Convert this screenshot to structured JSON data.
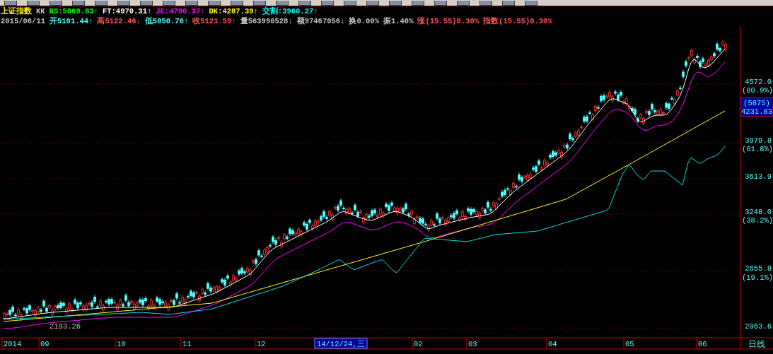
{
  "header": {
    "line_1": [
      {
        "text": "上证指数",
        "color": "#ffff00"
      },
      {
        "text": "KK",
        "color": "#c0c0c0"
      },
      {
        "text": "BS:5069.83↑",
        "color": "#00ff00"
      },
      {
        "text": "FT:4970.31↑",
        "color": "#ffffff"
      },
      {
        "text": "JE:4790.37↑",
        "color": "#ff00ff"
      },
      {
        "text": "DK:4287.39↑",
        "color": "#ffff00"
      },
      {
        "text": "交割:3960.27↑",
        "color": "#00ffff"
      }
    ],
    "line_2": [
      {
        "text": "2015/06/11",
        "color": "#c0c0c0"
      },
      {
        "text": "开5101.44↑",
        "color": "#54ffff"
      },
      {
        "text": "高5122.46↓",
        "color": "#ff5454"
      },
      {
        "text": "低5050.76↑",
        "color": "#54ffff"
      },
      {
        "text": "收5121.59↑",
        "color": "#ff5454"
      },
      {
        "text": "量563990528↓",
        "color": "#c0c0c0"
      },
      {
        "text": "额97467056↓",
        "color": "#c0c0c0"
      },
      {
        "text": "换0.00%",
        "color": "#c0c0c0"
      },
      {
        "text": "振1.40%",
        "color": "#c0c0c0"
      },
      {
        "text": "涨(15.55)0.30%",
        "color": "#ff5454"
      },
      {
        "text": "指数(15.55)0.30%",
        "color": "#ff5454"
      }
    ]
  },
  "chart": {
    "price_axis": [
      {
        "text": "4572.0",
        "kind": "price"
      },
      {
        "text": "(80.9%)",
        "kind": "ratio"
      },
      {
        "text": "3979.8",
        "kind": "price"
      },
      {
        "text": "(61.8%)",
        "kind": "ratio"
      },
      {
        "text": "3613.9",
        "kind": "price"
      },
      {
        "text": "3248.0",
        "kind": "price"
      },
      {
        "text": "(38.2%)",
        "kind": "ratio"
      },
      {
        "text": "2655.8",
        "kind": "price"
      },
      {
        "text": "(19.1%)",
        "kind": "ratio"
      },
      {
        "text": "2063.6",
        "kind": "price"
      }
    ],
    "cursor_box": [
      "(5875)",
      "4231.83"
    ],
    "low_marker": "2193.26"
  },
  "date_axis": {
    "labels": [
      "2014",
      "09",
      "10",
      "11",
      "12",
      "02",
      "03",
      "04",
      "05",
      "06"
    ],
    "cursor_date": "14/12/24,三",
    "period": "日线"
  }
}
